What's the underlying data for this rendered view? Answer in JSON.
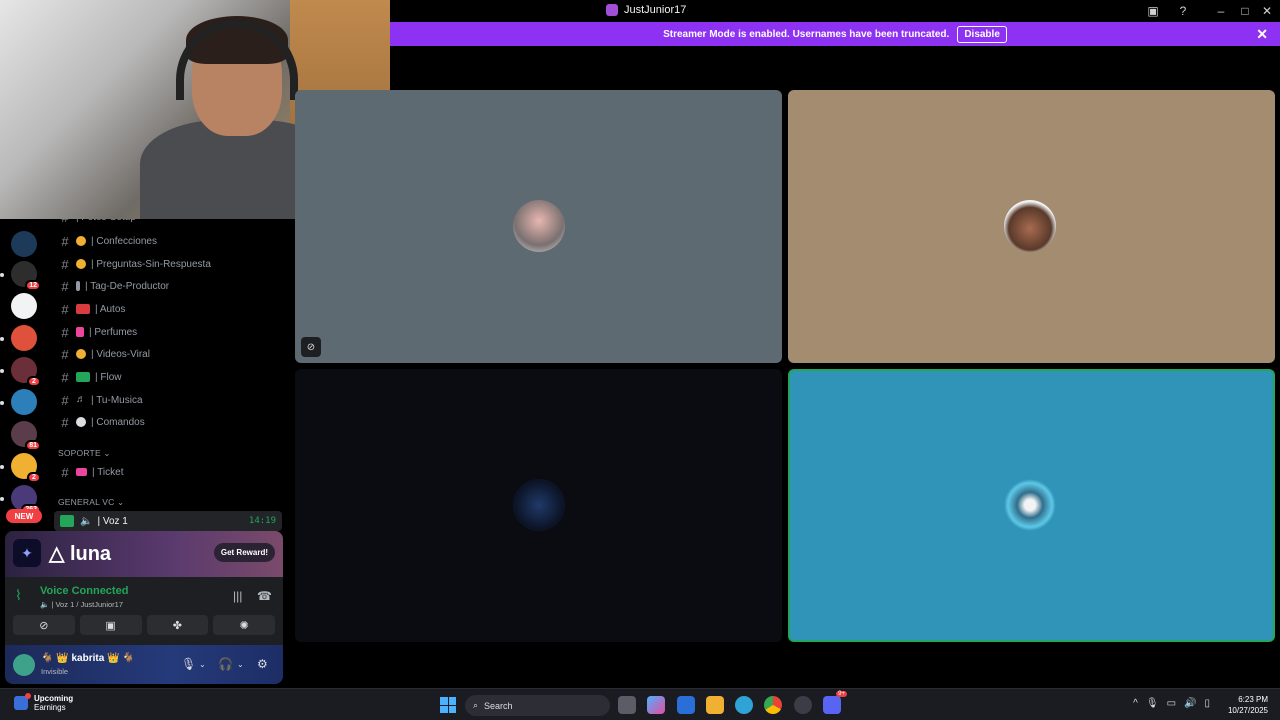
{
  "window": {
    "title": "JustJunior17",
    "icons": [
      "cast-icon",
      "help-icon",
      "minimize-icon",
      "maximize-icon",
      "close-icon"
    ]
  },
  "streamer_banner": {
    "message": "Streamer Mode is enabled. Usernames have been truncated.",
    "button": "Disable",
    "close": "✕"
  },
  "channels": {
    "partial_top": "| Fotos-Setup",
    "items": [
      {
        "label": "| Confecciones",
        "emoji_color": "#f0b132"
      },
      {
        "label": "| Preguntas-Sin-Respuesta",
        "emoji_color": "#f0b132"
      },
      {
        "label": "| Tag-De-Productor",
        "emoji_color": "#949ba4"
      },
      {
        "label": "| Autos",
        "emoji_color": "#d83c3e"
      },
      {
        "label": "| Perfumes",
        "emoji_color": "#eb459e"
      },
      {
        "label": "| Videos-Viral",
        "emoji_color": "#f0b132"
      },
      {
        "label": "| Flow",
        "emoji_color": "#23a55a"
      },
      {
        "label": "| Tu-Musica",
        "emoji_color": "#949ba4"
      },
      {
        "label": "| Comandos",
        "emoji_color": "#dbdee1"
      }
    ],
    "category_soporte": "SOPORTE",
    "ticket": "| Ticket",
    "category_general": "GENERAL VC",
    "voice_channel": "| Voz 1",
    "voice_time": "14:19"
  },
  "servers": {
    "badges": [
      "12",
      "2",
      "81",
      "2",
      "262"
    ],
    "new_label": "NEW"
  },
  "promo": {
    "name": "luna",
    "button": "Get Reward!"
  },
  "voice": {
    "status": "Voice Connected",
    "detail": "| Voz 1 / JustJunior17"
  },
  "account": {
    "username": "kabrita",
    "status": "Invisible"
  },
  "taskbar": {
    "widget_title": "Upcoming",
    "widget_sub": "Earnings",
    "search_placeholder": "Search",
    "time": "6:23 PM",
    "date": "10/27/2025",
    "discord_badge": "9+"
  }
}
